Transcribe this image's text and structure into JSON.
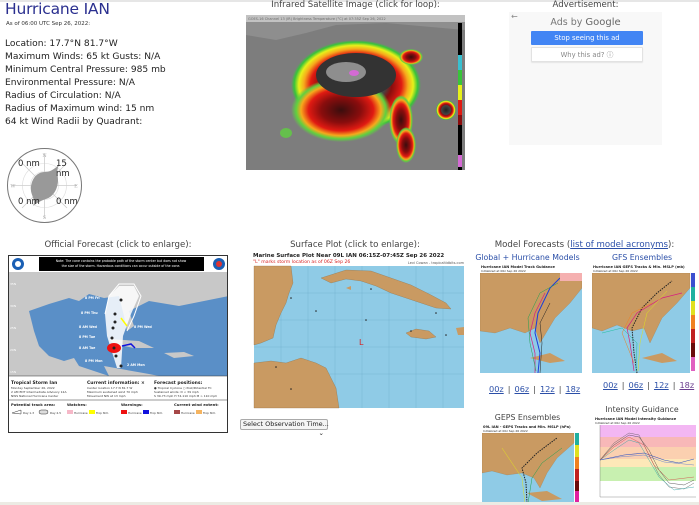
{
  "storm": {
    "title": "Hurricane IAN",
    "as_of": "As of 06:00 UTC Sep 26, 2022:",
    "info_lines": [
      "Location: 17.7°N 81.7°W",
      "Maximum Winds: 65 kt  Gusts: N/A",
      "Minimum Central Pressure: 985 mb",
      "Environmental Pressure: N/A",
      "Radius of Circulation: N/A",
      "Radius of Maximum wind: 15 nm",
      "64 kt Wind Radii by Quadrant:"
    ],
    "wind_radii": {
      "nw": "0 nm",
      "ne": "15 nm",
      "sw": "0 nm",
      "se": "0 nm",
      "compass": {
        "n": "N",
        "s": "S",
        "e": "E",
        "w": "W"
      }
    }
  },
  "satellite": {
    "heading": "Infrared Satellite Image (click for loop):",
    "image_title": "GOES-16 Channel 13 (IR) Brightness Temperature (°C) at 07:35Z Sep 26, 2022"
  },
  "advertisement": {
    "heading": "Advertisement:",
    "back_icon": "←",
    "ads_by": "Ads by",
    "brand": "Google",
    "stop_button": "Stop seeing this ad",
    "why_button": "Why this ad? ⓘ"
  },
  "official_forecast": {
    "heading": "Official Forecast (click to enlarge):",
    "note": "Note: The cone contains the probable path of the storm center but does not show the size of the storm. Hazardous conditions can occur outside of the cone.",
    "track_points": [
      "8 PM Fri",
      "8 PM Thu",
      "8 AM Wed",
      "8 PM Wed",
      "8 PM Tue",
      "8 AM Tue",
      "8 PM Mon",
      "2 AM Mon"
    ],
    "lat_labels": [
      "35N",
      "30N",
      "25N",
      "20N",
      "15N"
    ],
    "lon_labels": [
      "100W",
      "95W",
      "90W",
      "85W",
      "80W",
      "75W",
      "70W",
      "65W"
    ],
    "storm_name": "Tropical Storm Ian",
    "storm_date": "Monday September 26, 2022",
    "advisory": "2 AM EDT Intermediate Advisory 12A",
    "center": "NWS National Hurricane Center",
    "current_info_title": "Current information: ×",
    "current_info": [
      "Center location 17.7 N 81.7 W",
      "Maximum sustained wind 70 mph",
      "Movement NW at 13 mph"
    ],
    "forecast_pos_title": "Forecast positions:",
    "forecast_pos": [
      "● Tropical Cyclone  ○ Post/Potential TC",
      "Sustained winds:    D < 39 mph",
      "S 39-73 mph  H 74-110 mph  M > 110 mph"
    ],
    "legend": {
      "track_title": "Potential track area:",
      "track_items": [
        "Day 1-3",
        "Day 4-5"
      ],
      "watches_title": "Watches:",
      "watches": [
        {
          "label": "Hurricane",
          "color": "#f6b8c8"
        },
        {
          "label": "Trop Stm",
          "color": "#ffff00"
        }
      ],
      "warnings_title": "Warnings:",
      "warnings": [
        {
          "label": "Hurricane",
          "color": "#ee1111"
        },
        {
          "label": "Trop Stm",
          "color": "#1111dd"
        }
      ],
      "wind_title": "Current wind extent:",
      "wind": [
        {
          "label": "Hurricane",
          "color": "#a64747"
        },
        {
          "label": "Trop Stm",
          "color": "#f5b460"
        }
      ]
    }
  },
  "surface_plot": {
    "heading": "Surface Plot (click to enlarge):",
    "title": "Marine Surface Plot Near 09L IAN 06:15Z-07:45Z Sep 26 2022",
    "subtitle": "\"L\" marks storm location as of 06Z Sep 26",
    "credit": "Levi Cowan - tropicaltidbits.com",
    "storm_marker": "L",
    "select_label": "Select Observation Time...",
    "select_arrow": "⌄"
  },
  "model_forecasts": {
    "heading_prefix": "Model Forecasts (",
    "heading_link": "list of model acronyms",
    "heading_suffix": "):",
    "global": {
      "title": "Global + Hurricane Models",
      "image_title": "Hurricane IAN Model Track Guidance",
      "image_sub": "Initialized at 06z Sep 26 2022",
      "runs": [
        "00z",
        "06z",
        "12z",
        "18z"
      ]
    },
    "gfs": {
      "title": "GFS Ensembles",
      "image_title": "Hurricane IAN GEFS Tracks & Min. MSLP (mb)",
      "image_sub": "Initialized at 06z Sep 26 2022",
      "runs": [
        "00z",
        "06z",
        "12z",
        "18z"
      ]
    },
    "geps": {
      "title": "GEPS Ensembles",
      "image_title": "09L IAN - GEPS Tracks and Min. MSLP (hPa)",
      "image_sub": "Initialized at 00z Sep 26 2022"
    },
    "intensity": {
      "title": "Intensity Guidance",
      "image_title": "Hurricane IAN Model Intensity Guidance",
      "image_sub": "Initialized at 06z Sep 26 2022"
    },
    "separator": "|"
  }
}
